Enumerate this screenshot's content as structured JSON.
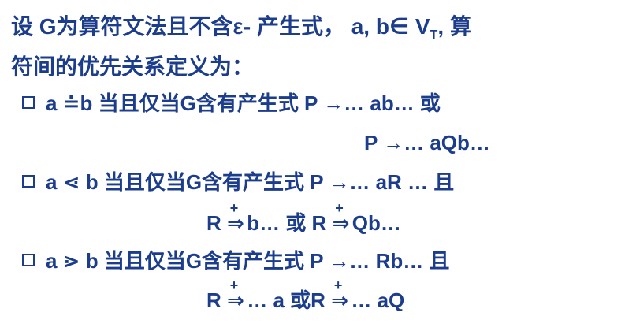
{
  "intro": {
    "line1_a": "设 G为算符文法且不含ε- 产生式，  a, b∈ V",
    "line1_sub": "T",
    "line1_b": ", 算",
    "line2": "符间的优先关系定义为："
  },
  "rules": [
    {
      "lead": "a ",
      "op": "≐",
      "rest": "b  当且仅当G含有产生式 P →… ab… 或",
      "cont": "P →… aQb…"
    },
    {
      "lead": "a ",
      "op": "⋖",
      "rest": " b 当且仅当G含有产生式 P →… aR … 且",
      "cont_a": "R ",
      "cont_arrow": "⇒",
      "cont_plus": "+",
      "cont_b": " b… 或 R ",
      "cont_arrow2": "⇒",
      "cont_plus2": "+",
      "cont_c": " Qb…"
    },
    {
      "lead": "a ",
      "op": "⋗",
      "rest": " b 当且仅当G含有产生式 P →… Rb… 且",
      "cont_a": "R ",
      "cont_arrow": "⇒",
      "cont_plus": "+",
      "cont_b": " … a 或R ",
      "cont_arrow2": "⇒",
      "cont_plus2": "+",
      "cont_c": " … aQ"
    }
  ]
}
